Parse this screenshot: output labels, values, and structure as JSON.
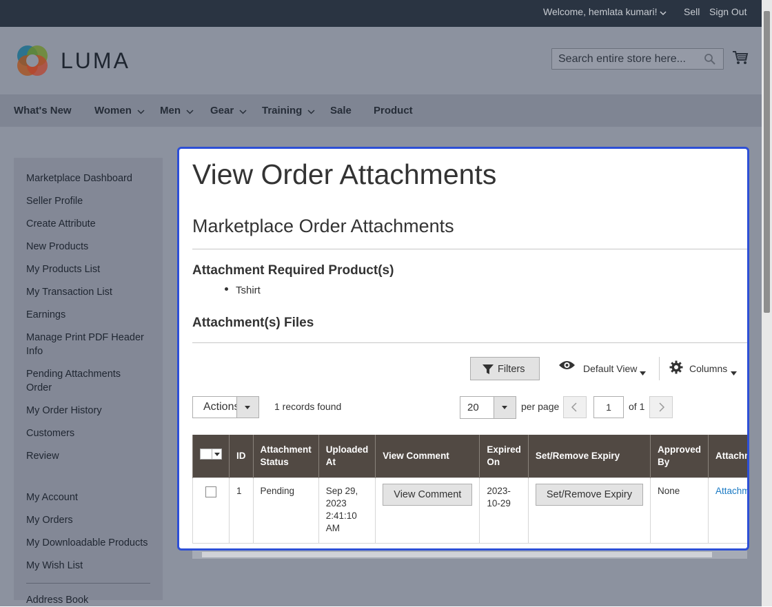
{
  "header": {
    "welcome": "Welcome, hemlata kumari!",
    "sell": "Sell",
    "sign_out": "Sign Out",
    "logo_text": "LUMA",
    "search_placeholder": "Search entire store here..."
  },
  "nav": {
    "items": [
      {
        "label": "What's New",
        "has_menu": false
      },
      {
        "label": "Women",
        "has_menu": true
      },
      {
        "label": "Men",
        "has_menu": true
      },
      {
        "label": "Gear",
        "has_menu": true
      },
      {
        "label": "Training",
        "has_menu": true
      },
      {
        "label": "Sale",
        "has_menu": false
      },
      {
        "label": "Product",
        "has_menu": false
      }
    ]
  },
  "sidebar": {
    "marketplace_links": [
      "Marketplace Dashboard",
      "Seller Profile",
      "Create Attribute",
      "New Products",
      "My Products List",
      "My Transaction List",
      "Earnings",
      "Manage Print PDF Header Info",
      "Pending Attachments Order",
      "My Order History",
      "Customers",
      "Review"
    ],
    "account_links": [
      "My Account",
      "My Orders",
      "My Downloadable Products",
      "My Wish List",
      "Address Book"
    ]
  },
  "main": {
    "title": "View Order Attachments",
    "subtitle": "Marketplace Order Attachments",
    "required_heading": "Attachment Required Product(s)",
    "required_products": [
      "Tshirt"
    ],
    "files_heading": "Attachment(s) Files"
  },
  "toolbar": {
    "filters_label": "Filters",
    "view_label": "Default View",
    "columns_label": "Columns",
    "actions_label": "Actions",
    "records_found": "1 records found",
    "per_page_value": "20",
    "per_page_label": "per page",
    "page_value": "1",
    "page_of": "of 1"
  },
  "grid": {
    "columns": [
      "ID",
      "Attachment Status",
      "Uploaded At",
      "View Comment",
      "Expired On",
      "Set/Remove Expiry",
      "Approved By",
      "Attachm"
    ],
    "rows": [
      {
        "id": "1",
        "status": "Pending",
        "uploaded_at": "Sep 29, 2023 2:41:10 AM",
        "view_comment_label": "View Comment",
        "expired_on": "2023-10-29",
        "set_expiry_label": "Set/Remove Expiry",
        "approved_by": "None",
        "attachment_link": "Attachm"
      }
    ]
  },
  "colors": {
    "accent_border": "#2d4fd6",
    "grid_header_bg": "#514943",
    "link": "#1979c3"
  }
}
